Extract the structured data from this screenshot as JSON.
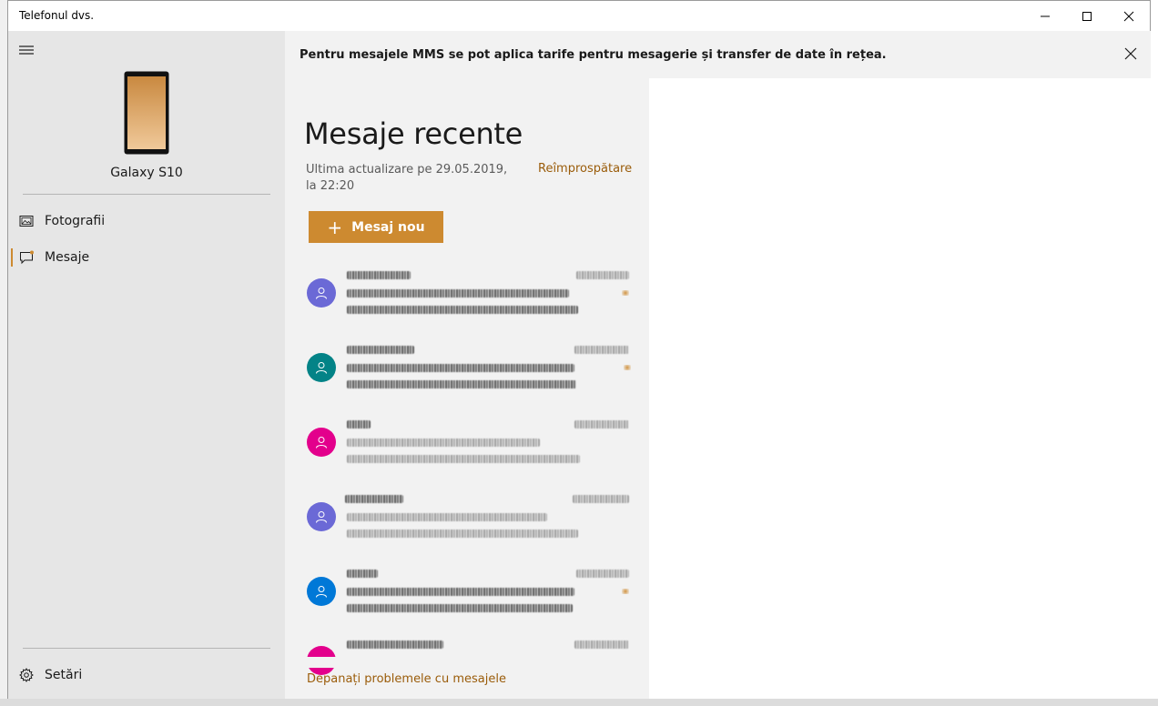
{
  "window": {
    "title": "Telefonul dvs."
  },
  "sidebar": {
    "device_name": "Galaxy S10",
    "items": [
      {
        "label": "Fotografii",
        "icon": "photos-icon",
        "active": false
      },
      {
        "label": "Mesaje",
        "icon": "message-icon",
        "active": true
      }
    ],
    "settings_label": "Setări"
  },
  "banner": {
    "text": "Pentru mesajele MMS se pot aplica tarife pentru mesagerie și transfer de date în rețea."
  },
  "messages": {
    "heading": "Mesaje recente",
    "last_update": "Ultima actualizare pe 29.05.2019, la 22:20",
    "refresh_label": "Reîmprospătare",
    "new_message_label": "Mesaj nou",
    "troubleshoot_label": "Depanați problemele cu mesajele",
    "conversations": [
      {
        "avatar_color": "#6b69d6"
      },
      {
        "avatar_color": "#038387"
      },
      {
        "avatar_color": "#e3008c"
      },
      {
        "avatar_color": "#6b69d6"
      },
      {
        "avatar_color": "#0078d7"
      },
      {
        "avatar_color": "#e3008c"
      }
    ]
  },
  "colors": {
    "accent": "#cd8a30",
    "link": "#9a5c0a"
  }
}
